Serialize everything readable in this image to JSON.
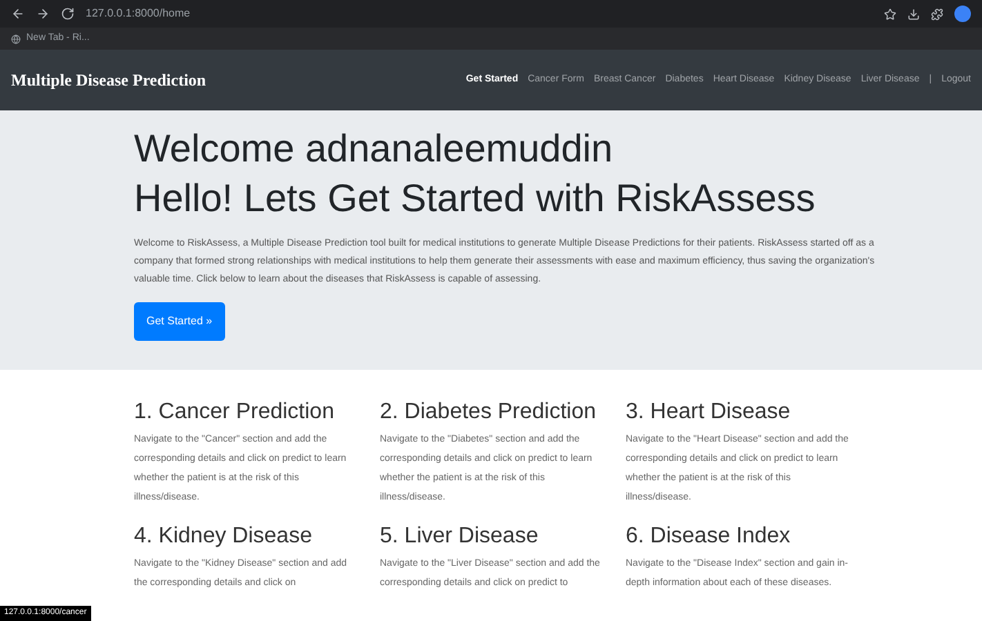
{
  "browser": {
    "url": "127.0.0.1:8000/home",
    "bookmark": "New Tab - Ri..."
  },
  "navbar": {
    "brand": "Multiple Disease Prediction",
    "links": [
      {
        "label": "Get Started",
        "selected": true
      },
      {
        "label": "Cancer Form",
        "selected": false
      },
      {
        "label": "Breast Cancer",
        "selected": false
      },
      {
        "label": "Diabetes",
        "selected": false
      },
      {
        "label": "Heart Disease",
        "selected": false
      },
      {
        "label": "Kidney Disease",
        "selected": false
      },
      {
        "label": "Liver Disease",
        "selected": false
      },
      {
        "label": "|",
        "selected": false
      },
      {
        "label": "Logout",
        "selected": false
      }
    ]
  },
  "hero": {
    "greeting": "Welcome adnanaleemuddin",
    "title": "Hello! Lets Get Started with RiskAssess",
    "text": "Welcome to RiskAssess, a Multiple Disease Prediction tool built for medical institutions to generate Multiple Disease Predictions for their patients. RiskAssess started off as a company that formed strong relationships with medical institutions to help them generate their assessments with ease and maximum efficiency, thus saving the organization's valuable time. Click below to learn about the diseases that RiskAssess is capable of assessing.",
    "button": "Get Started »"
  },
  "cards": [
    {
      "title": "1. Cancer Prediction",
      "text": "Navigate to the \"Cancer\" section and add the corresponding details and click on predict to learn whether the patient is at the risk of this illness/disease."
    },
    {
      "title": "2. Diabetes Prediction",
      "text": "Navigate to the \"Diabetes\" section and add the corresponding details and click on predict to learn whether the patient is at the risk of this illness/disease."
    },
    {
      "title": "3. Heart Disease",
      "text": "Navigate to the \"Heart Disease\" section and add the corresponding details and click on predict to learn whether the patient is at the risk of this illness/disease."
    },
    {
      "title": "4. Kidney Disease",
      "text": "Navigate to the \"Kidney Disease\" section and add the corresponding details and click on"
    },
    {
      "title": "5. Liver Disease",
      "text": "Navigate to the \"Liver Disease\" section and add the corresponding details and click on predict to"
    },
    {
      "title": "6. Disease Index",
      "text": "Navigate to the \"Disease Index\" section and gain in-depth information about each of these diseases."
    }
  ],
  "status_url": "127.0.0.1:8000/cancer"
}
